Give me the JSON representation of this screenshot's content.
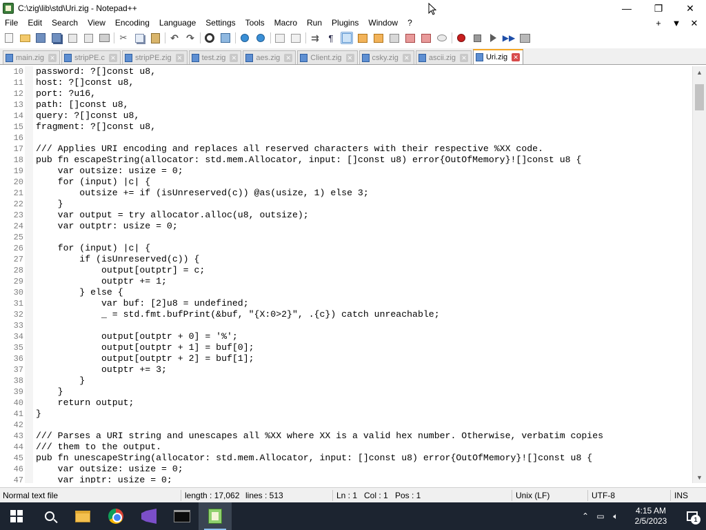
{
  "window": {
    "title": "C:\\zig\\lib\\std\\Uri.zig - Notepad++",
    "minimize_glyph": "—",
    "maximize_glyph": "❐",
    "close_glyph": "✕"
  },
  "menu": {
    "items": [
      "File",
      "Edit",
      "Search",
      "View",
      "Encoding",
      "Language",
      "Settings",
      "Tools",
      "Macro",
      "Run",
      "Plugins",
      "Window",
      "?"
    ],
    "right_glyphs": [
      "+",
      "▼",
      "✕"
    ]
  },
  "toolbar": {
    "icons": [
      "new-file-icon",
      "open-file-icon",
      "save-icon",
      "save-all-icon",
      "close-icon",
      "close-all-icon",
      "print-icon",
      "cut-icon",
      "copy-icon",
      "paste-icon",
      "undo-icon",
      "redo-icon",
      "find-icon",
      "replace-icon",
      "zoom-in-icon",
      "zoom-out-icon",
      "sync-vertical-icon",
      "sync-horizontal-icon",
      "word-wrap-icon",
      "show-all-chars-icon",
      "indent-guide-icon",
      "lang-define-icon",
      "doc-map-icon",
      "function-list-icon",
      "folder-workspace-icon",
      "monitoring-icon",
      "record-macro-icon",
      "stop-macro-icon",
      "play-macro-icon",
      "run-macro-multiple-icon",
      "save-macro-icon"
    ]
  },
  "tabs": [
    {
      "label": "main.zig",
      "active": false
    },
    {
      "label": "stripPE.c",
      "active": false
    },
    {
      "label": "stripPE.zig",
      "active": false
    },
    {
      "label": "test.zig",
      "active": false
    },
    {
      "label": "aes.zig",
      "active": false
    },
    {
      "label": "Client.zig",
      "active": false
    },
    {
      "label": "csky.zig",
      "active": false
    },
    {
      "label": "ascii.zig",
      "active": false
    },
    {
      "label": "Uri.zig",
      "active": true
    }
  ],
  "editor": {
    "lines": [
      {
        "num": "10",
        "text": "password: ?[]const u8,"
      },
      {
        "num": "11",
        "text": "host: ?[]const u8,"
      },
      {
        "num": "12",
        "text": "port: ?u16,"
      },
      {
        "num": "13",
        "text": "path: []const u8,"
      },
      {
        "num": "14",
        "text": "query: ?[]const u8,"
      },
      {
        "num": "15",
        "text": "fragment: ?[]const u8,"
      },
      {
        "num": "16",
        "text": ""
      },
      {
        "num": "17",
        "text": "/// Applies URI encoding and replaces all reserved characters with their respective %XX code."
      },
      {
        "num": "18",
        "text": "pub fn escapeString(allocator: std.mem.Allocator, input: []const u8) error{OutOfMemory}![]const u8 {"
      },
      {
        "num": "19",
        "text": "    var outsize: usize = 0;"
      },
      {
        "num": "20",
        "text": "    for (input) |c| {"
      },
      {
        "num": "21",
        "text": "        outsize += if (isUnreserved(c)) @as(usize, 1) else 3;"
      },
      {
        "num": "22",
        "text": "    }"
      },
      {
        "num": "23",
        "text": "    var output = try allocator.alloc(u8, outsize);"
      },
      {
        "num": "24",
        "text": "    var outptr: usize = 0;"
      },
      {
        "num": "25",
        "text": ""
      },
      {
        "num": "26",
        "text": "    for (input) |c| {"
      },
      {
        "num": "27",
        "text": "        if (isUnreserved(c)) {"
      },
      {
        "num": "28",
        "text": "            output[outptr] = c;"
      },
      {
        "num": "29",
        "text": "            outptr += 1;"
      },
      {
        "num": "30",
        "text": "        } else {"
      },
      {
        "num": "31",
        "text": "            var buf: [2]u8 = undefined;"
      },
      {
        "num": "32",
        "text": "            _ = std.fmt.bufPrint(&buf, \"{X:0>2}\", .{c}) catch unreachable;"
      },
      {
        "num": "33",
        "text": ""
      },
      {
        "num": "34",
        "text": "            output[outptr + 0] = '%';"
      },
      {
        "num": "35",
        "text": "            output[outptr + 1] = buf[0];"
      },
      {
        "num": "36",
        "text": "            output[outptr + 2] = buf[1];"
      },
      {
        "num": "37",
        "text": "            outptr += 3;"
      },
      {
        "num": "38",
        "text": "        }"
      },
      {
        "num": "39",
        "text": "    }"
      },
      {
        "num": "40",
        "text": "    return output;"
      },
      {
        "num": "41",
        "text": "}"
      },
      {
        "num": "42",
        "text": ""
      },
      {
        "num": "43",
        "text": "/// Parses a URI string and unescapes all %XX where XX is a valid hex number. Otherwise, verbatim copies"
      },
      {
        "num": "44",
        "text": "/// them to the output."
      },
      {
        "num": "45",
        "text": "pub fn unescapeString(allocator: std.mem.Allocator, input: []const u8) error{OutOfMemory}![]const u8 {"
      },
      {
        "num": "46",
        "text": "    var outsize: usize = 0;"
      },
      {
        "num": "47",
        "text": "    var inptr: usize = 0;"
      }
    ]
  },
  "statusbar": {
    "file_type": "Normal text file",
    "length": "length : 17,062",
    "lines": "lines : 513",
    "ln": "Ln : 1",
    "col": "Col : 1",
    "pos": "Pos : 1",
    "eol": "Unix (LF)",
    "encoding": "UTF-8",
    "mode": "INS"
  },
  "taskbar": {
    "apps": [
      "start-icon",
      "search-icon",
      "file-explorer-icon",
      "chrome-icon",
      "visual-studio-icon",
      "terminal-icon",
      "notepadpp-icon"
    ],
    "time": "4:15 AM",
    "date": "2/5/2023",
    "notification_count": "1"
  }
}
